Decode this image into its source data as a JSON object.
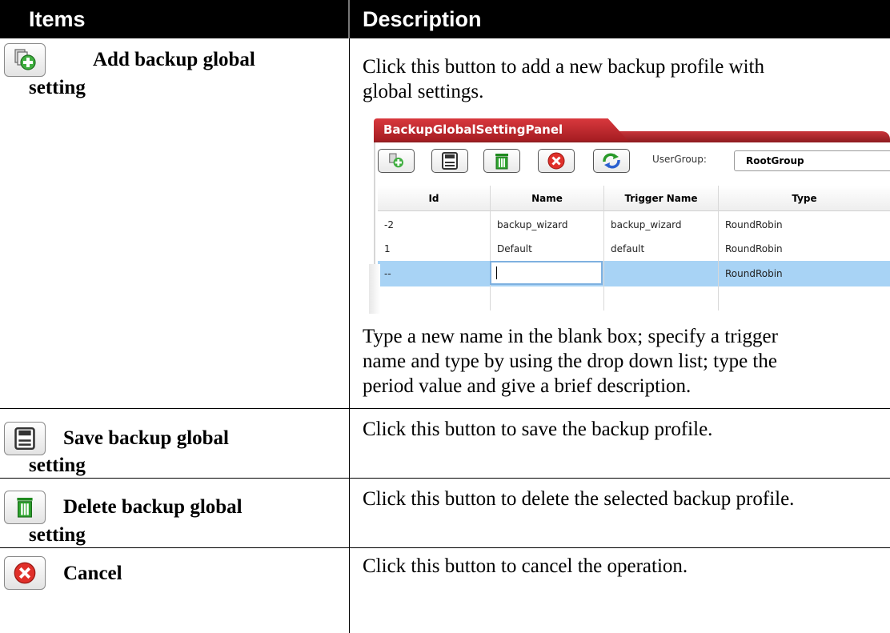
{
  "table": {
    "header": {
      "items": "Items",
      "description": "Description"
    },
    "rows": [
      {
        "icon": "add-icon",
        "title_line1": "Add backup global",
        "title_line2": "setting",
        "desc_intro_1": "Click this button to add a new backup profile with",
        "desc_intro_2": "global settings.",
        "desc_after_1": "Type a new name in the blank box; specify a trigger",
        "desc_after_2": "name and type by using the drop down list; type the",
        "desc_after_3": "period value and give a brief description."
      },
      {
        "icon": "save-icon",
        "title_line1": "Save backup global",
        "title_line2": "setting",
        "desc": "Click this button to save the backup profile."
      },
      {
        "icon": "trash-icon",
        "title_line1": "Delete backup global",
        "title_line2": "setting",
        "desc": "Click this button to delete the selected backup profile."
      },
      {
        "icon": "cancel-icon",
        "title_line1": "Cancel",
        "desc": "Click this button to cancel the operation."
      }
    ]
  },
  "panel": {
    "title": "BackupGlobalSettingPanel",
    "usergroup_label": "UserGroup:",
    "usergroup_value": "RootGroup",
    "columns": [
      "Id",
      "Name",
      "Trigger Name",
      "Type"
    ],
    "rows": [
      [
        "-2",
        "backup_wizard",
        "backup_wizard",
        "RoundRobin"
      ],
      [
        "1",
        "Default",
        "default",
        "RoundRobin"
      ],
      [
        "--",
        "",
        "",
        "RoundRobin"
      ]
    ],
    "colors": {
      "tab_red": "#c8353a",
      "selected_row": "#a8d3f5"
    }
  }
}
